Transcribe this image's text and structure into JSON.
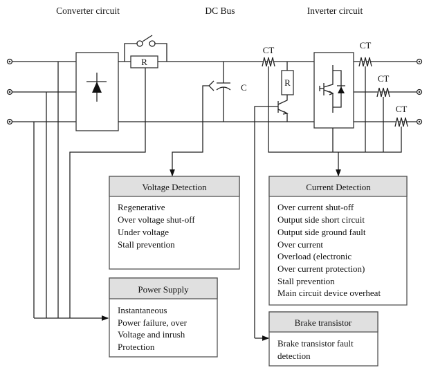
{
  "titles": {
    "converter": "Converter circuit",
    "dc_bus": "DC Bus",
    "inverter": "Inverter circuit"
  },
  "components": {
    "resistor": "R",
    "brake_resistor": "R",
    "capacitor": "C",
    "ct": "CT"
  },
  "boxes": {
    "voltage": {
      "title": "Voltage Detection",
      "items": [
        "Regenerative",
        "Over voltage shut-off",
        "Under voltage",
        "Stall prevention"
      ]
    },
    "power": {
      "title": "Power Supply",
      "items": [
        "Instantaneous",
        "Power failure, over",
        "Voltage and inrush",
        "Protection"
      ]
    },
    "current": {
      "title": "Current Detection",
      "items": [
        "Over current shut-off",
        "Output side short circuit",
        "Output side ground fault",
        "Over current",
        "Overload (electronic",
        "Over current protection)",
        "Stall prevention",
        "Main circuit device overheat"
      ]
    },
    "brake": {
      "title": "Brake transistor",
      "items": [
        "Brake transistor fault",
        "detection"
      ]
    }
  },
  "colors": {
    "header_fill": "#e0e0e0",
    "line": "#222222"
  }
}
